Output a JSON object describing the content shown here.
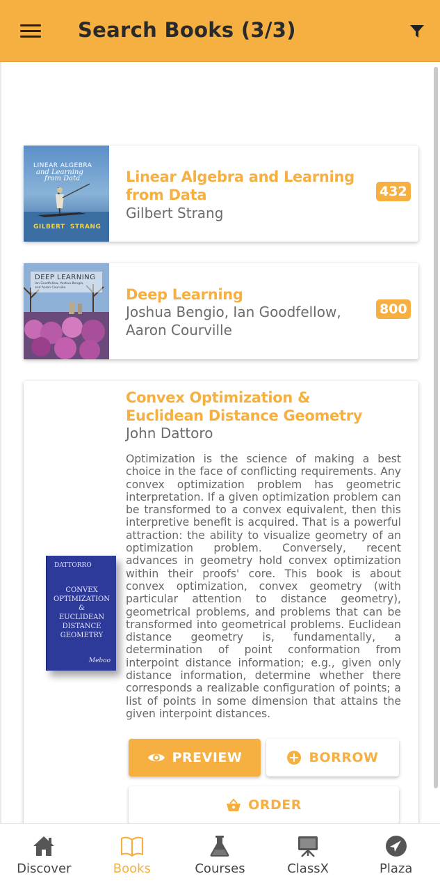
{
  "app_bar": {
    "title": "Search Books (3/3)",
    "menu_icon": "menu-icon",
    "filter_icon": "filter-icon"
  },
  "colors": {
    "accent": "#f5b041",
    "text_dark": "#2a2a2a",
    "text_muted": "#6b6b6b"
  },
  "books": [
    {
      "title": "Linear Algebra and Learning from Data",
      "author": "Gilbert Strang",
      "count": "432"
    },
    {
      "title": "Deep Learning",
      "author": "Joshua Bengio, Ian Goodfellow, Aaron Courville",
      "count": "800"
    },
    {
      "title": "Convex Optimization & Euclidean Distance Geometry",
      "author": "John Dattoro",
      "description": "Optimization is the science of making a best choice in the face of conflicting requirements. Any convex optimization problem has geometric interpretation. If a given optimization problem can be transformed to a convex equivalent, then this interpretive benefit is acquired. That is a powerful attraction: the ability to visualize geometry of an optimization problem. Conversely, recent advances in geometry hold convex optimization within their proofs' core. This book is about convex optimization, convex geometry (with particular attention to distance geometry), geometrical problems, and problems that can be transformed into geometrical problems. Euclidean distance geometry is, fundamentally, a determination of point conformation from interpoint distance information; e.g., given only distance information, determine whether there corresponds a realizable configuration of points; a list of points in some dimension that attains the given interpoint distances.",
      "actions": {
        "preview": "PREVIEW",
        "borrow": "BORROW",
        "order": "ORDER"
      }
    }
  ],
  "covers": {
    "linear_algebra": {
      "line1": "LINEAR ALGEBRA",
      "line2": "and Learning",
      "line3": "from Data",
      "author": "GILBERT  STRANG"
    },
    "deep_learning": {
      "line1": "DEEP LEARNING",
      "line2": "Ian Goodfellow, Yoshua Bengio,",
      "line3": "and Aaron Courville"
    },
    "convex": {
      "author": "DATTORRO",
      "t1": "CONVEX",
      "t2": "OPTIMIZATION",
      "t3": "&",
      "t4": "EUCLIDEAN",
      "t5": "DISTANCE",
      "t6": "GEOMETRY",
      "publisher": "Meboo"
    }
  },
  "bottom_nav": [
    {
      "label": "Discover",
      "icon": "home-icon",
      "active": false
    },
    {
      "label": "Books",
      "icon": "book-icon",
      "active": true
    },
    {
      "label": "Courses",
      "icon": "flask-icon",
      "active": false
    },
    {
      "label": "ClassX",
      "icon": "easel-icon",
      "active": false
    },
    {
      "label": "Plaza",
      "icon": "compass-icon",
      "active": false
    }
  ]
}
